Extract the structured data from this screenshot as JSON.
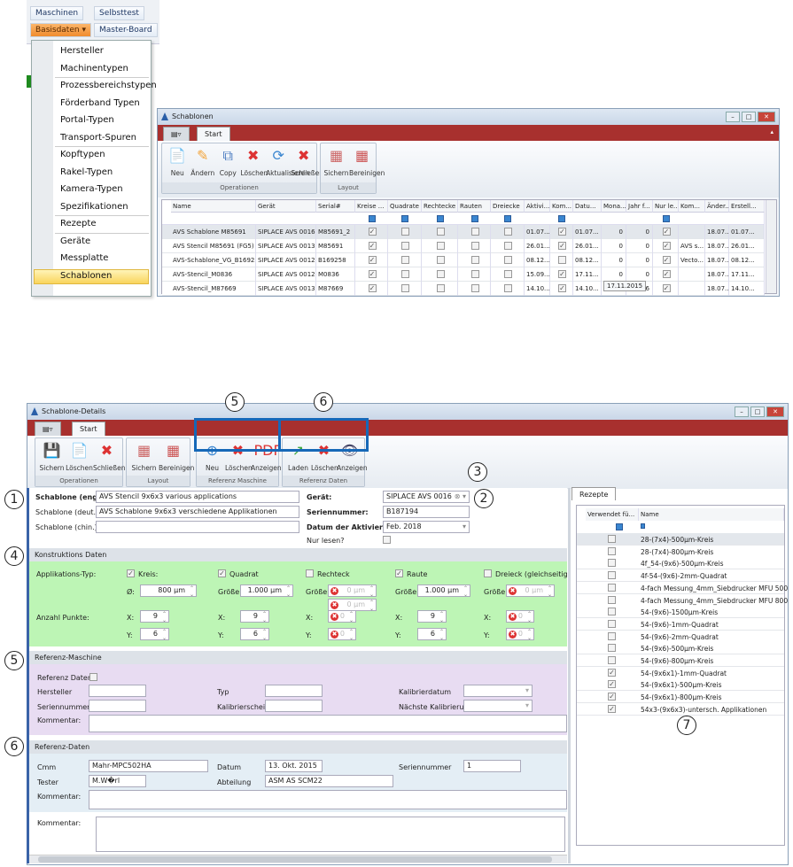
{
  "topmenu": {
    "buttons": [
      "Maschinen",
      "Selbsttest",
      "Basisdaten",
      "Master-Board"
    ],
    "items": [
      "Hersteller",
      "Machinentypen",
      "Prozessbereichstypen",
      "Förderband Typen",
      "Portal-Typen",
      "Transport-Spuren",
      "Kopftypen",
      "Rakel-Typen",
      "Kamera-Typen",
      "Spezifikationen",
      "Rezepte",
      "Geräte",
      "Messplatte",
      "Schablonen"
    ],
    "selected": "Schablonen"
  },
  "list_window": {
    "title": "Schablonen",
    "tab": "Start",
    "ops": [
      "Neu",
      "Ändern",
      "Copy",
      "Löschen",
      "Aktualisieren",
      "Schließen"
    ],
    "ops_group": "Operationen",
    "layout": [
      "Sichern",
      "Bereinigen"
    ],
    "layout_group": "Layout",
    "columns": [
      "Name",
      "Gerät",
      "Serial#",
      "Kreise ...",
      "Quadrate",
      "Rechtecke",
      "Rauten",
      "Dreiecke",
      "Aktivi...",
      "Kom...",
      "Datu...",
      "Mona...",
      "Jahr f...",
      "Nur le...",
      "Kom...",
      "Änder...",
      "Erstell..."
    ],
    "rows": [
      [
        "AVS Schablone M85691",
        "SIPLACE AVS 0016",
        "M85691_2",
        true,
        false,
        false,
        false,
        false,
        "01.07...",
        true,
        "01.07...",
        "0",
        "0",
        true,
        "",
        "18.07...",
        "01.07..."
      ],
      [
        "AVS Stencil M85691 (FG5)",
        "SIPLACE AVS 0013",
        "M85691",
        true,
        false,
        false,
        false,
        false,
        "26.01...",
        true,
        "26.01...",
        "0",
        "0",
        true,
        "AVS s...",
        "18.07...",
        "26.01..."
      ],
      [
        "AVS-Schablone_VG_B169258",
        "SIPLACE AVS 0012",
        "B169258",
        true,
        false,
        false,
        false,
        false,
        "08.12...",
        false,
        "08.12...",
        "0",
        "0",
        true,
        "Vecto...",
        "18.07...",
        "08.12..."
      ],
      [
        "AVS-Stencil_M0836",
        "SIPLACE AVS 0012",
        "M0836",
        true,
        false,
        false,
        false,
        false,
        "15.09...",
        true,
        "17.11...",
        "0",
        "0",
        true,
        "",
        "18.07...",
        "17.11..."
      ],
      [
        "AVS-Stencil_M87669",
        "SIPLACE AVS 0013",
        "M87669",
        true,
        false,
        false,
        false,
        false,
        "14.10...",
        true,
        "14.10...",
        "",
        "2016",
        true,
        "",
        "18.07...",
        "14.10..."
      ]
    ],
    "tooltip": "17.11.2015"
  },
  "details": {
    "title": "Schablone-Details",
    "tab": "Start",
    "ops": [
      "Sichern",
      "Löschen",
      "Schließen"
    ],
    "ops_group": "Operationen",
    "layout": [
      "Sichern",
      "Bereinigen"
    ],
    "layout_group": "Layout",
    "refm": [
      "Neu",
      "Löschen",
      "Anzeigen"
    ],
    "refm_group": "Referenz Maschine",
    "refd": [
      "Laden",
      "Löschen",
      "Anzeigen"
    ],
    "refd_group": "Referenz Daten",
    "engl_label": "Schablone (engl.):",
    "engl": "AVS Stencil 9x6x3 various applications",
    "deut_label": "Schablone (deut.):",
    "deut": "AVS Schablone 9x6x3 verschiedene Applikationen",
    "chin_label": "Schablone (chin.):",
    "chin": "",
    "geraet_label": "Gerät:",
    "geraet": "SIPLACE AVS 0016",
    "serial_label": "Seriennummer:",
    "serial": "B187194",
    "datum_label": "Datum der Aktivierung:",
    "datum": "Feb. 2018",
    "nurlesen_label": "Nur lesen?",
    "konst": {
      "header": "Konstruktions Daten",
      "apptyp": "Applikations-Typ:",
      "punkte": "Anzahl Punkte:",
      "kreis": "Kreis:",
      "quadrat": "Quadrat",
      "rechteck": "Rechteck",
      "raute": "Raute",
      "dreieck": "Dreieck (gleichseitig)",
      "d_label": "Ø:",
      "g_label": "Größe:",
      "x_label": "X:",
      "y_label": "Y:",
      "kreis_d": "800 µm",
      "quadrat_g": "1.000 µm",
      "rechteck_g1": "0 µm",
      "rechteck_g2": "0 µm",
      "raute_g": "1.000 µm",
      "dreieck_g": "0 µm",
      "kreis_x": "9",
      "kreis_y": "6",
      "quadrat_x": "9",
      "quadrat_y": "6",
      "rechteck_x": "0",
      "rechteck_y": "0",
      "raute_x": "9",
      "raute_y": "6",
      "dreieck_x": "0",
      "dreieck_y": "0"
    },
    "refmasch": {
      "header": "Referenz-Maschine",
      "refdaten": "Referenz Daten:",
      "hersteller": "Hersteller",
      "typ": "Typ",
      "kalibdatum": "Kalibrierdatum",
      "seriennr": "Seriennummer",
      "kalibschein": "Kalibrierschein",
      "naechste": "Nächste Kalibrierung",
      "kommentar": "Kommentar:"
    },
    "refdat": {
      "header": "Referenz-Daten",
      "cmm_label": "Cmm",
      "cmm": "Mahr-MPC502HA",
      "datum_label": "Datum",
      "datum": "13. Okt. 2015",
      "sn_label": "Seriennummer",
      "sn": "1",
      "tester_label": "Tester",
      "tester": "M.W�rl",
      "abt_label": "Abteilung",
      "abt": "ASM AS SCM22",
      "kommentar": "Kommentar:"
    },
    "kommentar": "Kommentar:",
    "rezepte": {
      "tab": "Rezepte",
      "col1": "Verwendet fü...",
      "col2": "Name",
      "rows": [
        [
          "28-(7x4)-500µm-Kreis",
          false
        ],
        [
          "28-(7x4)-800µm-Kreis",
          false
        ],
        [
          "4f_54-(9x6)-500µm-Kreis",
          false
        ],
        [
          "4f-54-(9x6)-2mm-Quadrat",
          false
        ],
        [
          "4-fach Messung_4mm_Siebdrucker MFU 500",
          false
        ],
        [
          "4-fach Messung_4mm_Siebdrucker MFU 800",
          false
        ],
        [
          "54-(9x6)-1500µm-Kreis",
          false
        ],
        [
          "54-(9x6)-1mm-Quadrat",
          false
        ],
        [
          "54-(9x6)-2mm-Quadrat",
          false
        ],
        [
          "54-(9x6)-500µm-Kreis",
          false
        ],
        [
          "54-(9x6)-800µm-Kreis",
          false
        ],
        [
          "54-(9x6x1)-1mm-Quadrat",
          true
        ],
        [
          "54-(9x6x1)-500µm-Kreis",
          true
        ],
        [
          "54-(9x6x1)-800µm-Kreis",
          true
        ],
        [
          "54x3-(9x6x3)-untersch. Applikationen",
          true
        ]
      ]
    }
  },
  "annotations": [
    "1",
    "2",
    "3",
    "4",
    "5",
    "6",
    "5",
    "6",
    "7"
  ]
}
